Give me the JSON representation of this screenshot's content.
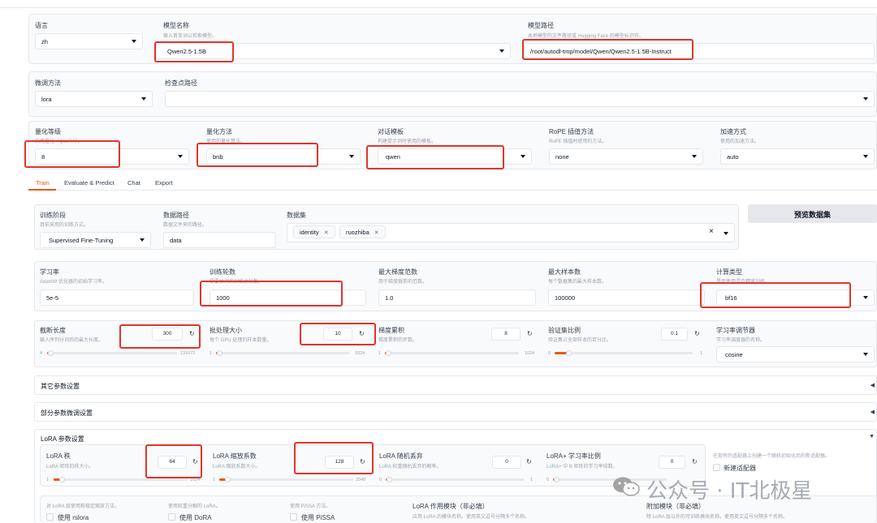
{
  "row1": {
    "language": {
      "label": "语言",
      "value": "zh"
    },
    "model_name": {
      "label": "模型名称",
      "hint": "输入首单词以检索模型。",
      "value": "Qwen2.5-1.5B"
    },
    "model_path": {
      "label": "模型路径",
      "hint": "本地模型的文件路径或 Hugging Face 的模型标识符。",
      "value": "/root/autodl-tmp/model/Qwen/Qwen2.5-1.5B-Instruct"
    }
  },
  "row2": {
    "finetune_method": {
      "label": "微调方法",
      "value": "lora"
    },
    "checkpoint_path": {
      "label": "检查点路径",
      "value": ""
    }
  },
  "row3": {
    "quant_bit": {
      "label": "量化等级",
      "hint": "启用量化（QLoRA）。",
      "value": "8"
    },
    "quant_method": {
      "label": "量化方法",
      "hint": "使用的量化算法。",
      "value": "bnb"
    },
    "template": {
      "label": "对话模板",
      "hint": "构建提示词时使用的模板。",
      "value": "qwen"
    },
    "rope": {
      "label": "RoPE 插值方法",
      "hint": "RoPE 插值时使用的方法。",
      "value": "none"
    },
    "booster": {
      "label": "加速方式",
      "hint": "使用的加速方法。",
      "value": "auto"
    }
  },
  "tabs": [
    "Train",
    "Evaluate & Predict",
    "Chat",
    "Export"
  ],
  "train": {
    "stage": {
      "label": "训练阶段",
      "hint": "目前采用的训练方式。",
      "value": "Supervised Fine-Tuning"
    },
    "dataset_dir": {
      "label": "数据路径",
      "hint": "数据文件夹的路径。",
      "value": "data"
    },
    "dataset": {
      "label": "数据集",
      "chips": [
        "identity",
        "ruozhiba"
      ],
      "clear": "×"
    },
    "preview_button": "预览数据集",
    "learning_rate": {
      "label": "学习率",
      "hint": "AdamW 优化器的初始学习率。",
      "value": "5e-5"
    },
    "epochs": {
      "label": "训练轮数",
      "hint": "需要执行的训练总轮数。",
      "value": "1000"
    },
    "max_grad_norm": {
      "label": "最大梯度范数",
      "hint": "用于梯度裁剪的范数。",
      "value": "1.0"
    },
    "max_samples": {
      "label": "最大样本数",
      "hint": "每个数据集的最大样本数。",
      "value": "100000"
    },
    "compute_type": {
      "label": "计算类型",
      "hint": "是否使用混合精度训练。",
      "value": "bf16"
    },
    "cutoff_len": {
      "label": "截断长度",
      "hint": "输入序列分词后的最大长度。",
      "value": "300",
      "min": "4",
      "max": "131072",
      "fraction": 0.002
    },
    "batch_size": {
      "label": "批处理大小",
      "hint": "每个 GPU 处理的样本数量。",
      "value": "10",
      "min": "1",
      "max": "1024",
      "fraction": 0.009
    },
    "grad_accum": {
      "label": "梯度累积",
      "hint": "梯度累积的步数。",
      "value": "8",
      "min": "1",
      "max": "1024",
      "fraction": 0.007
    },
    "val_size": {
      "label": "验证集比例",
      "hint": "验证集占全部样本的百分比。",
      "value": "0.1",
      "min": "0",
      "max": "1",
      "fraction": 0.1
    },
    "lr_scheduler": {
      "label": "学习率调节器",
      "hint": "学习率调度器的名称。",
      "value": "cosine"
    },
    "accordions": {
      "other": "其它参数设置",
      "freeze": "部分参数微调设置",
      "lora": "LoRA 参数设置"
    },
    "lora": {
      "rank": {
        "label": "LoRA 秩",
        "hint": "LoRA 矩阵的秩大小。",
        "value": "64",
        "min": "1",
        "max": "1024",
        "fraction": 0.062
      },
      "alpha": {
        "label": "LoRA 缩放系数",
        "hint": "LoRA 缩放系数大小。",
        "value": "128",
        "min": "1",
        "max": "2048",
        "fraction": 0.062
      },
      "dropout": {
        "label": "LoRA 随机丢弃",
        "hint": "LoRA 权重随机丢弃的概率。",
        "value": "0",
        "min": "0",
        "max": "1",
        "fraction": 0
      },
      "plus_lr": {
        "label": "LoRA+ 学习率比例",
        "hint": "LoRA+ 中 B 矩阵的学习率倍数。",
        "value": "0",
        "min": "0",
        "max": "",
        "fraction": 0
      },
      "new_adapter": {
        "hint": "在现有的适配器上创建一个随机初始化后的新适配器。",
        "label": "新建适配器"
      },
      "rslora": {
        "hint": "对 LoRA 层使用秩稳定缩放方法。",
        "label": "使用 rslora"
      },
      "dora": {
        "hint": "使用权重分解的 LoRA。",
        "label": "使用 DoRA"
      },
      "pissa": {
        "hint": "使用 PiSSA 方法。",
        "label": "使用 PiSSA"
      },
      "target": {
        "label": "LoRA 作用模块（非必填）",
        "hint": "应用 LoRA 的模块名称。使用英文逗号分隔多个名称。"
      },
      "additional": {
        "label": "附加模块（非必填）",
        "hint": "除 LoRA 层以外的可训练模块名称。使用英文逗号分隔多个名称。"
      }
    }
  },
  "watermark": "公众号 · IT北极星",
  "colors": {
    "accent": "#ea580c",
    "highlight": "#e0352b"
  }
}
